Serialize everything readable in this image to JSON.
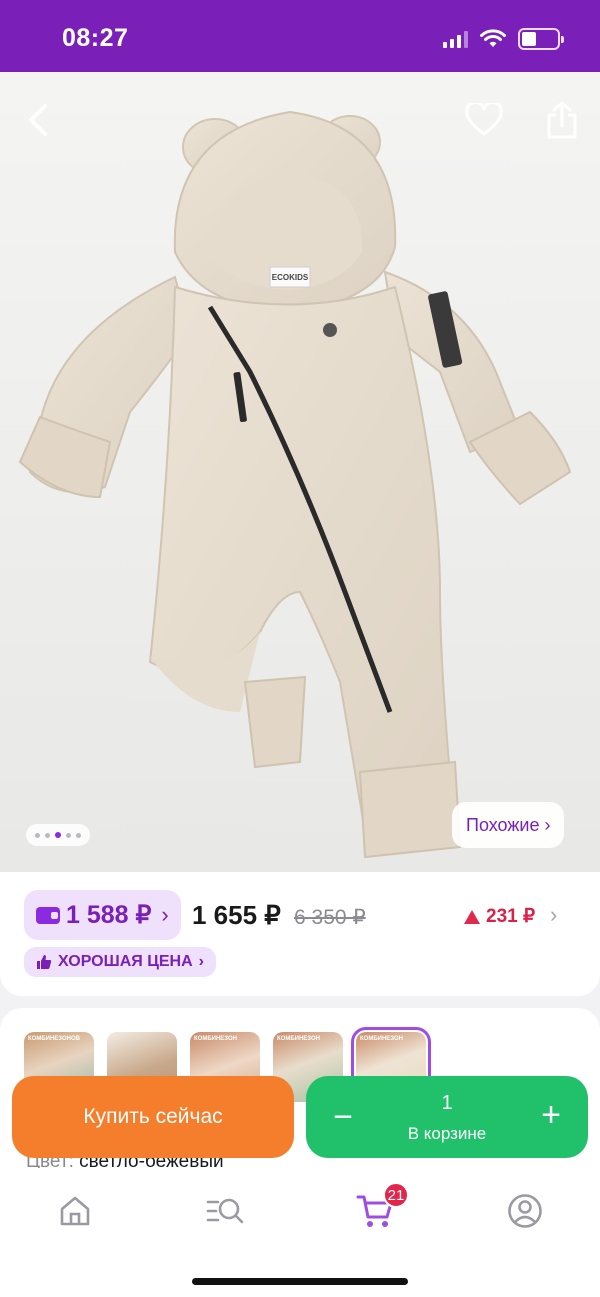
{
  "status_bar": {
    "time": "08:27",
    "battery_level": 0.4
  },
  "gallery": {
    "photo_brand_label": "ECOKIDS",
    "current_image_index": 3,
    "image_count": 5,
    "similar_label": "Похожие ›"
  },
  "pricing": {
    "wallet_price": "1 588 ₽",
    "wallet_chevron": "›",
    "regular_price": "1 655 ₽",
    "old_price": "6 350 ₽",
    "change_amount": "231 ₽",
    "change_chevron": "›",
    "good_price_label": "ХОРОШАЯ ЦЕНА",
    "good_price_chevron": "›"
  },
  "variants": {
    "thumbnail_captions": [
      "КОМБИНЕЗОНОВ",
      "",
      "КОМБИНЕЗОН",
      "КОМБИНЕЗОН",
      "КОМБИНЕЗОН"
    ],
    "selected_index": 4,
    "color_label": "Цвет:",
    "color_value": "светло-бежевый"
  },
  "actions": {
    "buy_now": "Купить сейчас",
    "cart_minus": "−",
    "cart_quantity": "1",
    "cart_plus": "+",
    "cart_label": "В корзине"
  },
  "tabbar": {
    "cart_badge": "21",
    "active_tab": "cart"
  },
  "colors": {
    "brand_purple": "#7a1fb8",
    "accent_orange": "#f47e2b",
    "accent_green": "#21c06b",
    "badge_red": "#e3244b"
  }
}
